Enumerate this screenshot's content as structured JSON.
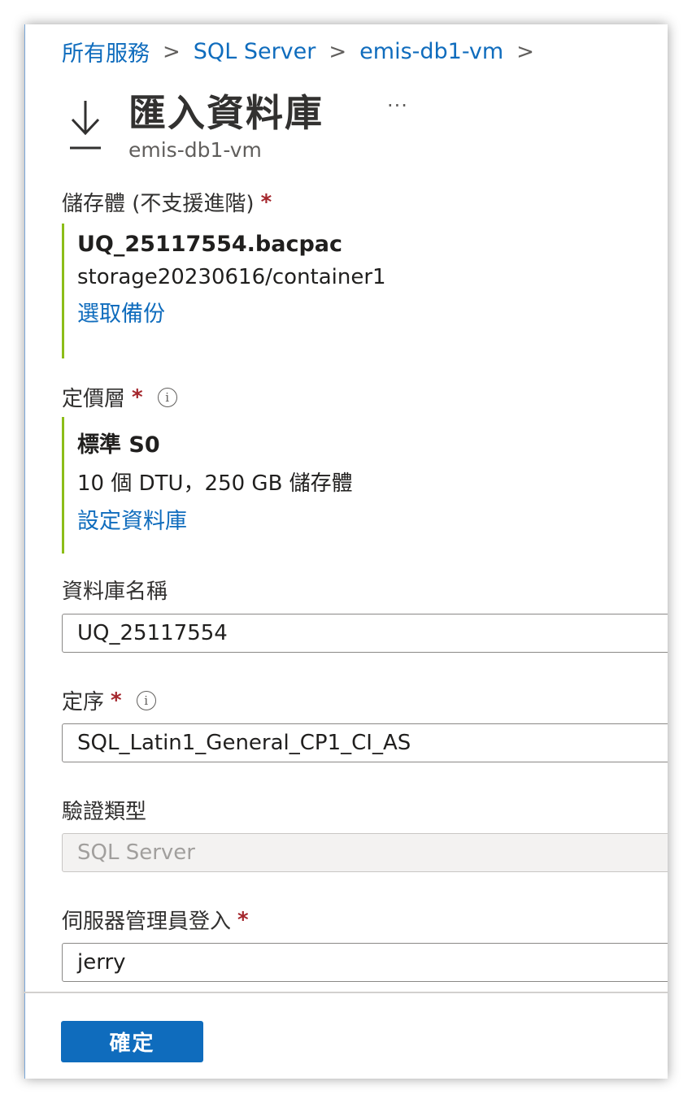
{
  "breadcrumb": [
    "所有服務",
    "SQL Server",
    "emis-db1-vm"
  ],
  "breadcrumb_separator": ">",
  "header": {
    "title": "匯入資料庫",
    "subtitle": "emis-db1-vm",
    "more": "···",
    "icon": "download-icon"
  },
  "storage": {
    "label": "儲存體 (不支援進階)",
    "required": "*",
    "file": "UQ_25117554.bacpac",
    "path": "storage20230616/container1",
    "link": "選取備份"
  },
  "tier": {
    "label": "定價層",
    "required": "*",
    "name": "標準 S0",
    "detail": "10 個 DTU，250 GB 儲存體",
    "link": "設定資料庫"
  },
  "db_name": {
    "label": "資料庫名稱",
    "value": "UQ_25117554"
  },
  "collation": {
    "label": "定序",
    "required": "*",
    "value": "SQL_Latin1_General_CP1_CI_AS"
  },
  "auth_type": {
    "label": "驗證類型",
    "value": "SQL Server"
  },
  "admin_login": {
    "label": "伺服器管理員登入",
    "required": "*",
    "value": "jerry"
  },
  "footer": {
    "ok_label": "確定"
  },
  "colors": {
    "accent": "#0f6cbd",
    "required": "#a4262c",
    "panel_border": "#8cbd18"
  }
}
